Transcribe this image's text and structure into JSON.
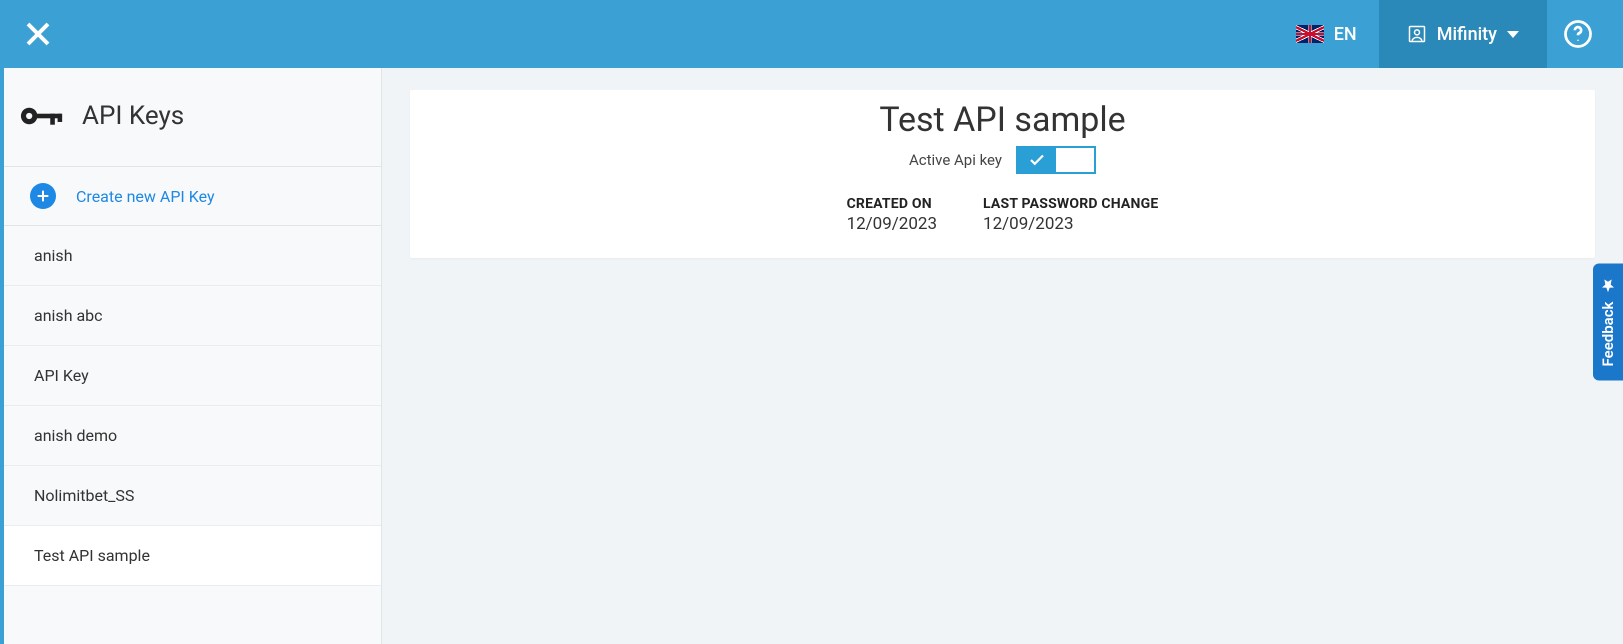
{
  "header": {
    "language_code": "EN",
    "account_name": "Mifinity"
  },
  "sidebar": {
    "title": "API Keys",
    "create_label": "Create new API Key",
    "items": [
      {
        "label": "anish"
      },
      {
        "label": "anish abc"
      },
      {
        "label": "API Key"
      },
      {
        "label": "anish demo"
      },
      {
        "label": "Nolimitbet_SS"
      },
      {
        "label": "Test API sample"
      }
    ],
    "selected_index": 5
  },
  "detail": {
    "title": "Test API sample",
    "active_label": "Active Api key",
    "active": true,
    "created_label": "CREATED ON",
    "created_value": "12/09/2023",
    "pwdchange_label": "LAST PASSWORD CHANGE",
    "pwdchange_value": "12/09/2023"
  },
  "feedback_label": "Feedback"
}
